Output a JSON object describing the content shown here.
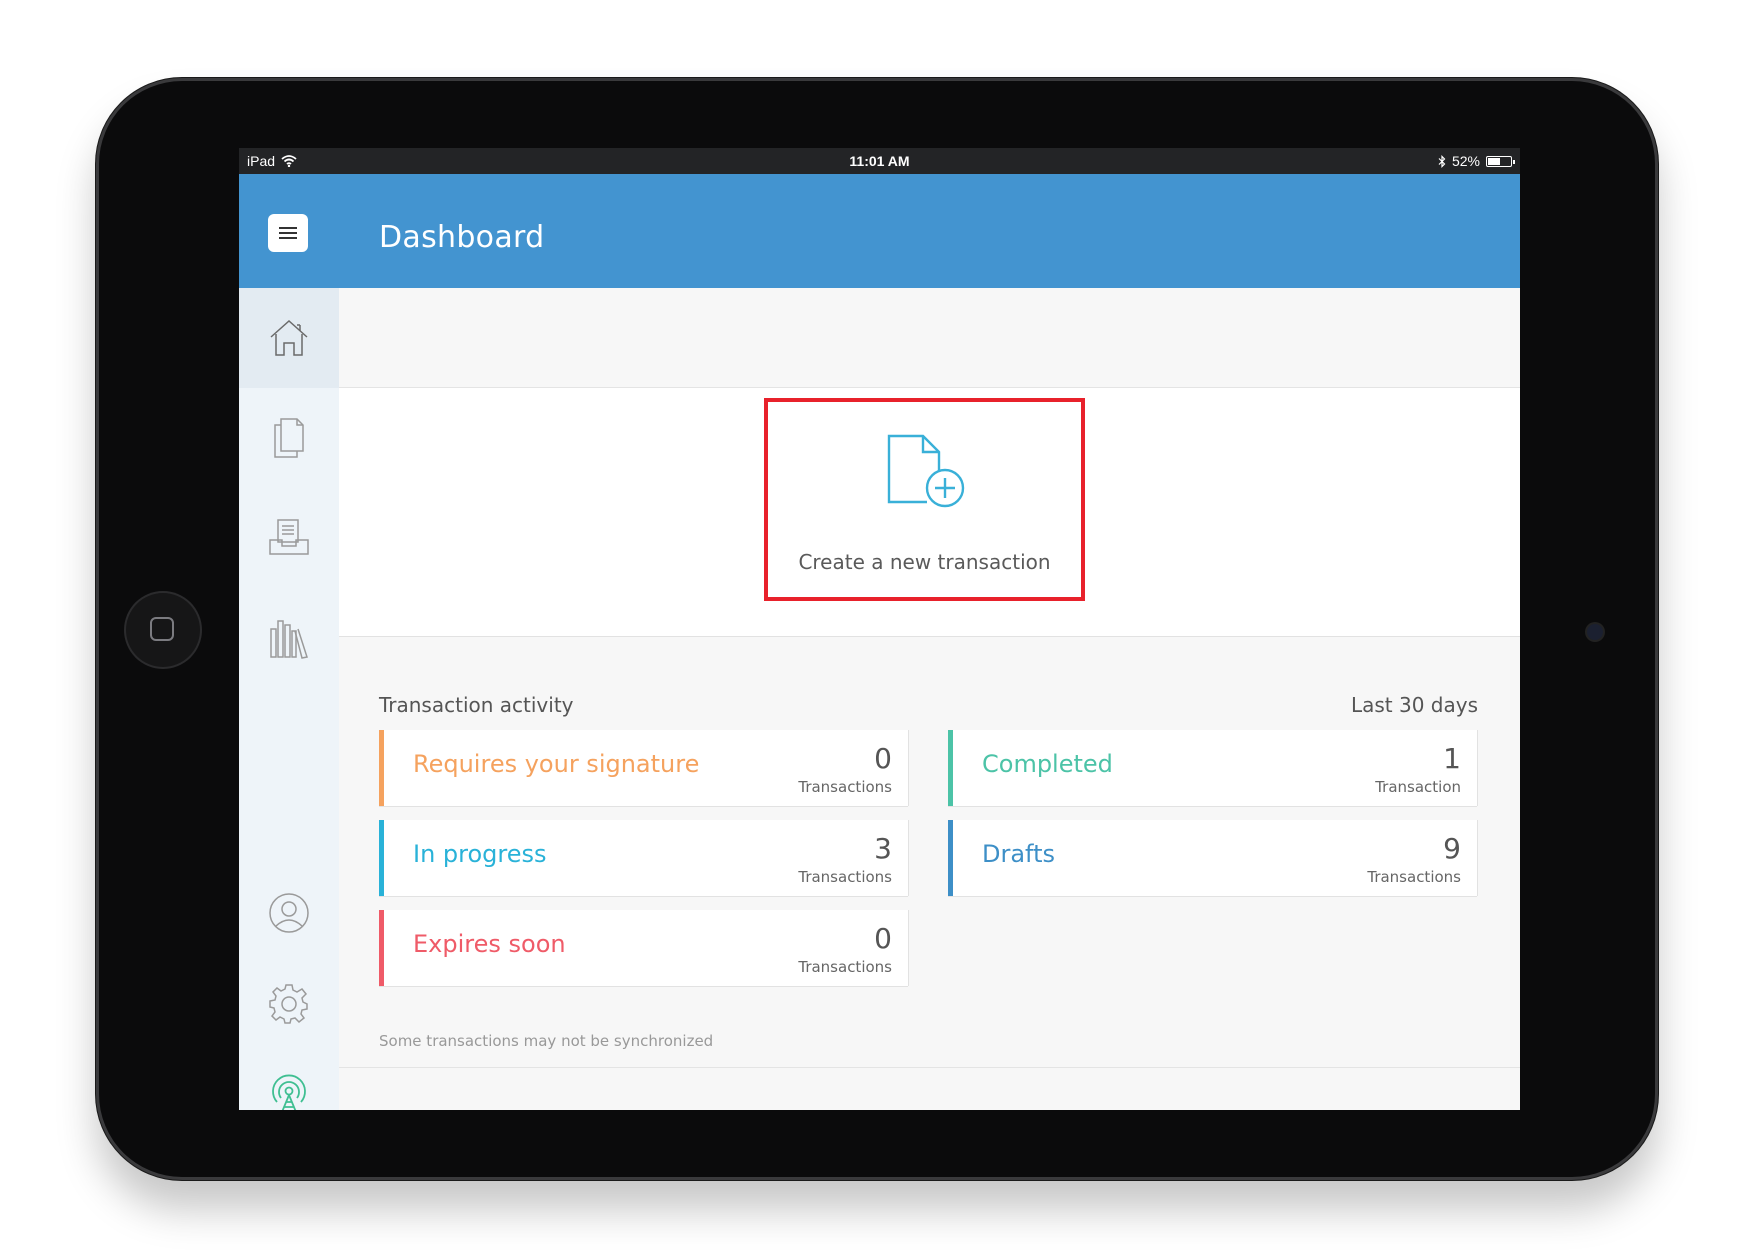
{
  "status_bar": {
    "device": "iPad",
    "time": "11:01 AM",
    "battery": "52%",
    "battery_level": 0.52
  },
  "header": {
    "title": "Dashboard"
  },
  "sidebar": {
    "items": [
      {
        "icon": "home-icon",
        "active": true
      },
      {
        "icon": "documents-icon",
        "active": false
      },
      {
        "icon": "inbox-tray-icon",
        "active": false
      },
      {
        "icon": "library-icon",
        "active": false
      },
      {
        "icon": "user-icon",
        "active": false
      },
      {
        "icon": "gear-icon",
        "active": false
      },
      {
        "icon": "signal-tower-icon",
        "active": false
      }
    ]
  },
  "create": {
    "label": "Create a new transaction"
  },
  "activity": {
    "heading": "Transaction activity",
    "range": "Last 30 days",
    "cards": [
      {
        "label": "Requires your signature",
        "count": "0",
        "unit": "Transactions",
        "color": "#f5a25e"
      },
      {
        "label": "Completed",
        "count": "1",
        "unit": "Transaction",
        "color": "#4cc3a7"
      },
      {
        "label": "In progress",
        "count": "3",
        "unit": "Transactions",
        "color": "#29b2d8"
      },
      {
        "label": "Drafts",
        "count": "9",
        "unit": "Transactions",
        "color": "#3d8fc7"
      },
      {
        "label": "Expires soon",
        "count": "0",
        "unit": "Transactions",
        "color": "#ef5b68"
      }
    ],
    "sync_note": "Some transactions may not be synchronized"
  }
}
